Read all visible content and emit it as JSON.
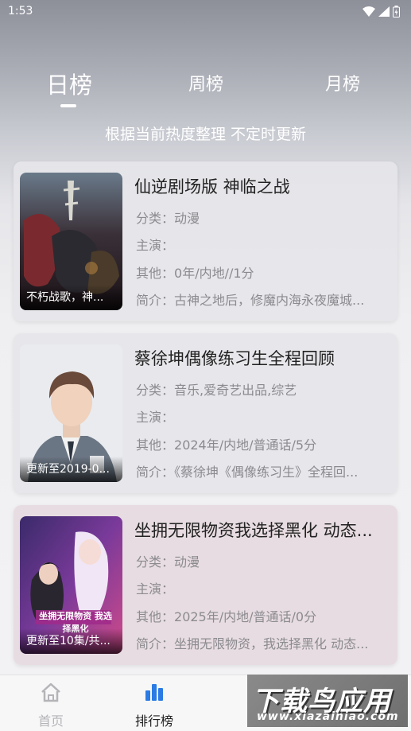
{
  "status_bar": {
    "time": "1:53"
  },
  "tabs": [
    {
      "label": "日榜",
      "active": true
    },
    {
      "label": "周榜",
      "active": false
    },
    {
      "label": "月榜",
      "active": false
    }
  ],
  "subtitle": "根据当前热度整理 不定时更新",
  "cards": [
    {
      "title": "仙逆剧场版 神临之战",
      "poster_caption": "不朽战歌，神...",
      "category_label": "分类：",
      "category": "动漫",
      "cast_label": "主演：",
      "cast": "",
      "other_label": "其他：",
      "other": "0年/内地//1分",
      "intro_label": "简介：",
      "intro": "古神之地后，修魔内海永夜魔城..."
    },
    {
      "title": "蔡徐坤偶像练习生全程回顾",
      "poster_caption": "更新至2019-0...",
      "category_label": "分类：",
      "category": "音乐,爱奇艺出品,综艺",
      "cast_label": "主演：",
      "cast": "",
      "other_label": "其他：",
      "other": "2024年/内地/普通话/5分",
      "intro_label": "简介：",
      "intro": "《蔡徐坤《偶像练习生》全程回..."
    },
    {
      "title": "坐拥无限物资我选择黑化 动态...",
      "poster_caption": "更新至10集/共...",
      "poster_art_text": "坐拥无限物资 我选择黑化",
      "category_label": "分类：",
      "category": "动漫",
      "cast_label": "主演：",
      "cast": "",
      "other_label": "其他：",
      "other": "2025年/内地/普通话/0分",
      "intro_label": "简介：",
      "intro": "坐拥无限物资，我选择黑化 动态..."
    }
  ],
  "bottom_nav": [
    {
      "label": "首页",
      "icon": "home-icon",
      "active": false
    },
    {
      "label": "排行榜",
      "icon": "chart-icon",
      "active": true
    }
  ],
  "watermark": {
    "main": "下载鸟应用",
    "url": "www.xiazainiao.com"
  }
}
